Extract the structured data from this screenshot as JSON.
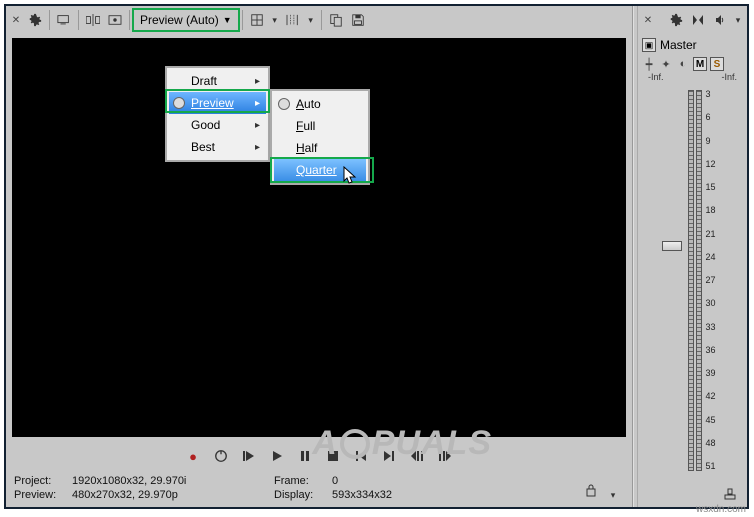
{
  "toolbar": {
    "preview_label": "Preview (Auto)"
  },
  "quality_menu": {
    "items": [
      "Draft",
      "Preview",
      "Good",
      "Best"
    ],
    "selected": "Preview"
  },
  "resolution_menu": {
    "items": [
      "Auto",
      "Full",
      "Half",
      "Quarter"
    ],
    "highlight": "Quarter"
  },
  "transport": {},
  "status": {
    "project_label": "Project:",
    "project_value": "1920x1080x32, 29.970i",
    "preview_label": "Preview:",
    "preview_value": "480x270x32, 29.970p",
    "frame_label": "Frame:",
    "frame_value": "0",
    "display_label": "Display:",
    "display_value": "593x334x32"
  },
  "master": {
    "title": "Master",
    "m": "M",
    "s": "S",
    "inf_left": "-Inf.",
    "inf_right": "-Inf.",
    "ticks": [
      "3",
      "6",
      "9",
      "12",
      "15",
      "18",
      "21",
      "24",
      "27",
      "30",
      "33",
      "36",
      "39",
      "42",
      "45",
      "48",
      "51"
    ]
  },
  "watermark": {
    "text_a": "A",
    "text_b": "PUALS"
  },
  "wsxdn": "wsxdn.com"
}
